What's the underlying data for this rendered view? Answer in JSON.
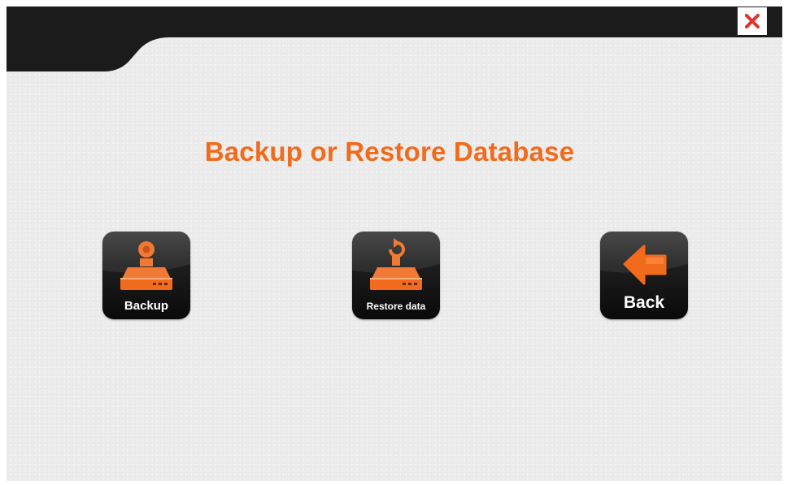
{
  "window": {
    "close_icon": "close-icon",
    "close_color": "#e0322a"
  },
  "main": {
    "title": "Backup or Restore Database",
    "title_color": "#f26a1b"
  },
  "actions": [
    {
      "id": "backup",
      "label": "Backup",
      "icon": "hard-drive-backup-icon"
    },
    {
      "id": "restore",
      "label": "Restore data",
      "icon": "hard-drive-restore-icon"
    },
    {
      "id": "back",
      "label": "Back",
      "icon": "arrow-left-icon"
    }
  ],
  "colors": {
    "accent": "#f26a1b",
    "bar": "#1b1b1b",
    "tile": "#111111",
    "background": "#ececec"
  }
}
